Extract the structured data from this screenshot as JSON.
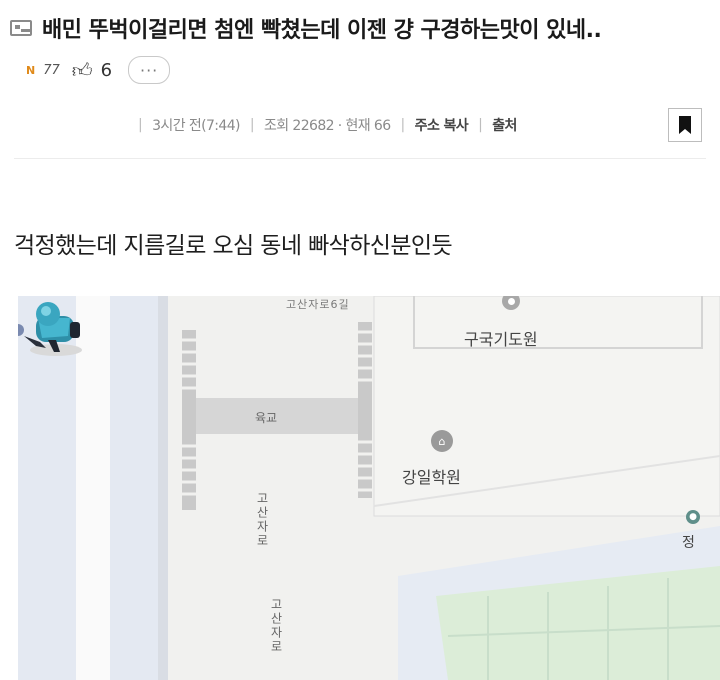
{
  "post": {
    "title": "배민 뚜벅이걸리면 첨엔 빡쳤는데 이젠 걍 구경하는맛이 있네..",
    "badge": "N",
    "views_short": "77",
    "likes": "6",
    "more": "···",
    "time": "3시간 전(7:44)",
    "views": "조회 22682 · 현재 66",
    "copy_address": "주소 복사",
    "source": "출처",
    "body": "걱정했는데 지름길로 오심 동네 빠삭하신분인듯"
  },
  "map": {
    "road_top": "고산자로6길",
    "poi_1": "구국기도원",
    "bridge": "육교",
    "academy": "강일학원",
    "road_mid": "고산자로",
    "road_bottom": "고산자로",
    "edge_label": "정"
  },
  "icons": {
    "image": "image-icon",
    "thumb": "thumbs-up-icon",
    "bookmark": "bookmark-icon",
    "pin": "map-pin-icon",
    "school": "school-icon",
    "rider": "delivery-rider-icon"
  }
}
